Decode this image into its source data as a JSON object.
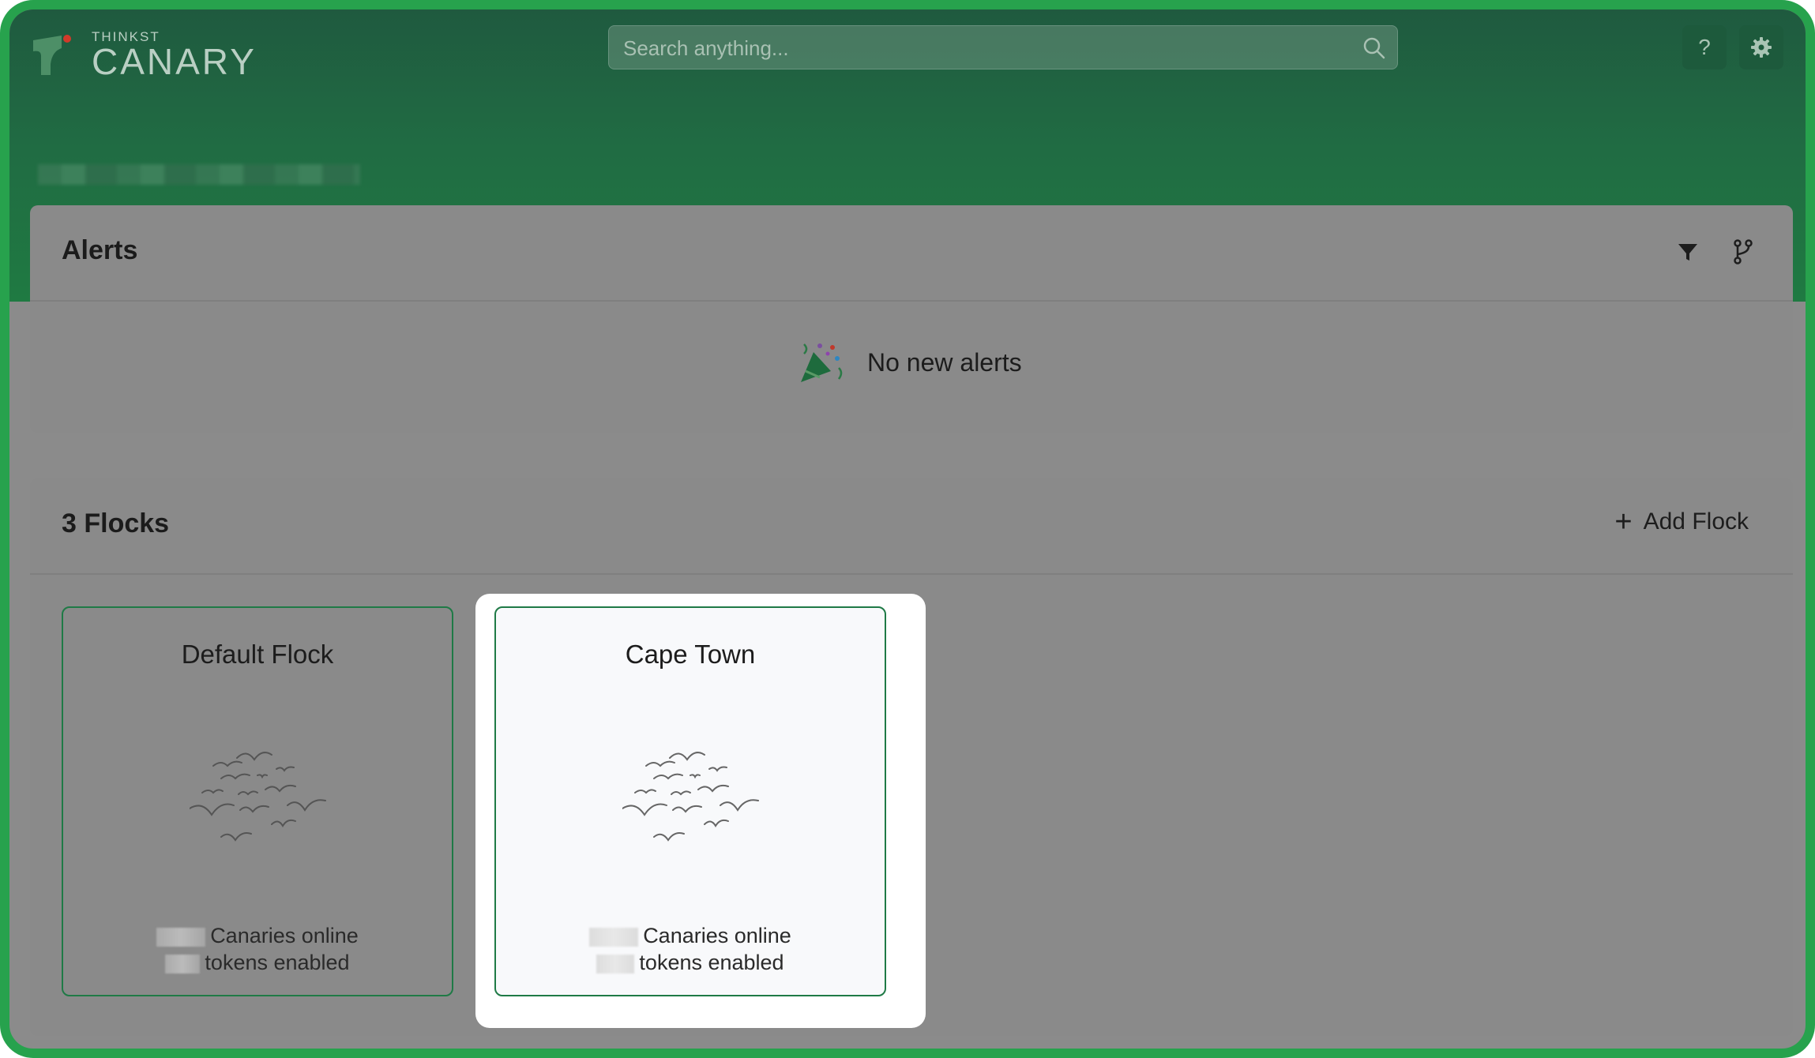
{
  "app": {
    "logo_small": "THINKST",
    "logo_big": "CANARY"
  },
  "header": {
    "search_placeholder": "Search anything...",
    "help_label": "?"
  },
  "alerts": {
    "title": "Alerts",
    "empty_message": "No new alerts"
  },
  "flocks": {
    "title": "3 Flocks",
    "add_label": "Add Flock",
    "items": [
      {
        "name": "Default Flock",
        "canaries_label": "Canaries online",
        "tokens_label": "tokens enabled"
      },
      {
        "name": "Cape Town",
        "canaries_label": "Canaries online",
        "tokens_label": "tokens enabled"
      }
    ]
  },
  "colors": {
    "accent": "#1f7a46",
    "frame": "#27a24d"
  }
}
